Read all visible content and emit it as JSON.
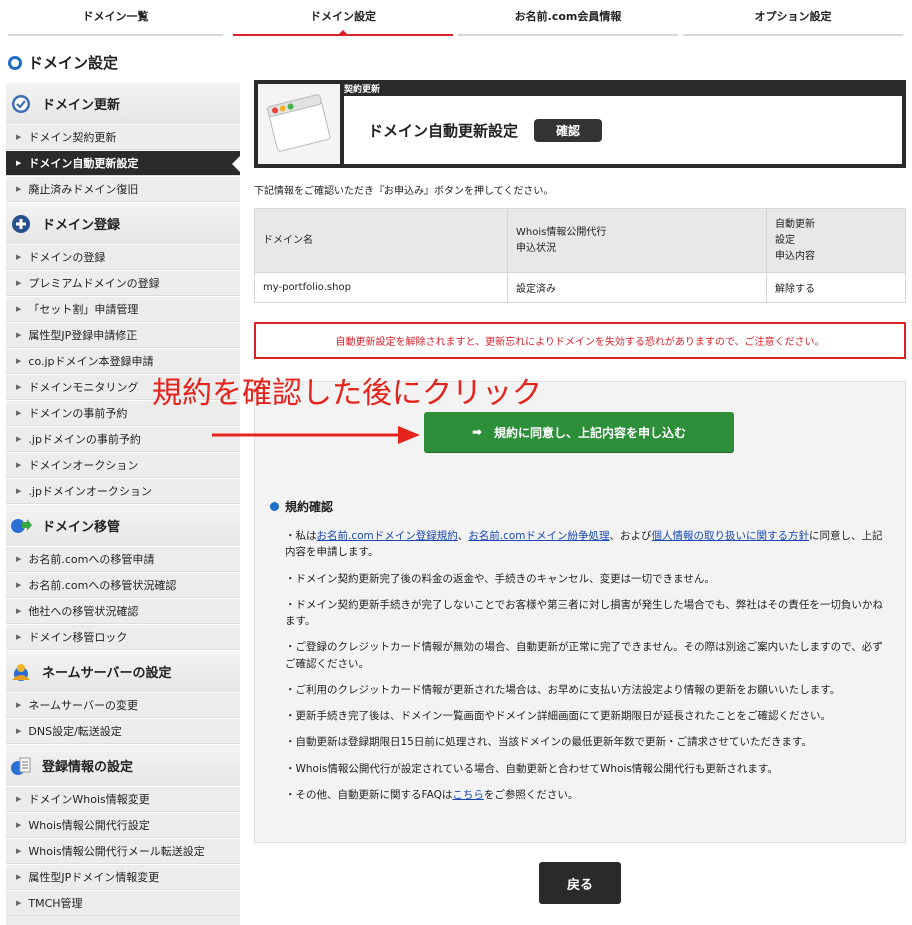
{
  "topnav": {
    "tabs": [
      {
        "label": "ドメイン一覧"
      },
      {
        "label": "ドメイン設定"
      },
      {
        "label": "お名前.com会員情報"
      },
      {
        "label": "オプション設定"
      }
    ]
  },
  "page_title": "ドメイン設定",
  "sidebar": {
    "sections": [
      {
        "title": "ドメイン更新",
        "icon": "check-circle-icon",
        "items": [
          "ドメイン契約更新",
          "ドメイン自動更新設定",
          "廃止済みドメイン復旧"
        ]
      },
      {
        "title": "ドメイン登録",
        "icon": "plus-circle-icon",
        "items": [
          "ドメインの登録",
          "プレミアムドメインの登録",
          "「セット割」申請管理",
          "属性型JP登録申請修正",
          "co.jpドメイン本登録申請",
          "ドメインモニタリング",
          "ドメインの事前予約",
          ".jpドメインの事前予約",
          "ドメインオークション",
          ".jpドメインオークション"
        ]
      },
      {
        "title": "ドメイン移管",
        "icon": "globe-arrow-icon",
        "items": [
          "お名前.comへの移管申請",
          "お名前.comへの移管状況確認",
          "他社への移管状況確認",
          "ドメイン移管ロック"
        ]
      },
      {
        "title": "ネームサーバーの設定",
        "icon": "user-globe-icon",
        "items": [
          "ネームサーバーの変更",
          "DNS設定/転送設定"
        ]
      },
      {
        "title": "登録情報の設定",
        "icon": "document-globe-icon",
        "items": [
          "ドメインWhois情報変更",
          "Whois情報公開代行設定",
          "Whois情報公開代行メール転送設定",
          "属性型JPドメイン情報変更",
          "TMCH管理"
        ]
      }
    ]
  },
  "hero": {
    "label": "契約更新",
    "heading": "ドメイン自動更新設定",
    "badge": "確認"
  },
  "instruction": "下記情報をご確認いただき『お申込み』ボタンを押してください。",
  "table": {
    "headers": [
      "ドメイン名",
      "Whois情報公開代行\n申込状況",
      "自動更新\n設定\n申込内容"
    ],
    "row": [
      "my-portfolio.shop",
      "設定済み",
      "解除する"
    ]
  },
  "warning": "自動更新設定を解除されますと、更新忘れによりドメインを失効する恐れがありますので、ご注意ください。",
  "annotation": "規約を確認した後にクリック",
  "agree_button": "規約に同意し、上記内容を申し込む",
  "terms": {
    "title": "規約確認",
    "p1_prefix": "・私は",
    "link1": "お名前.comドメイン登録規約",
    "sep1": "、",
    "link2": "お名前.comドメイン紛争処理",
    "sep2": "、および",
    "link3": "個人情報の取り扱いに関する方針",
    "p1_suffix": "に同意し、上記内容を申請します。",
    "p2": "・ドメイン契約更新完了後の料金の返金や、手続きのキャンセル、変更は一切できません。",
    "p3": "・ドメイン契約更新手続きが完了しないことでお客様や第三者に対し損害が発生した場合でも、弊社はその責任を一切負いかねます。",
    "p4": "・ご登録のクレジットカード情報が無効の場合、自動更新が正常に完了できません。その際は別途ご案内いたしますので、必ずご確認ください。",
    "p5": "・ご利用のクレジットカード情報が更新された場合は、お早めに支払い方法設定より情報の更新をお願いいたします。",
    "p6": "・更新手続き完了後は、ドメイン一覧画面やドメイン詳細画面にて更新期限日が延長されたことをご確認ください。",
    "p7": "・自動更新は登録期限日15日前に処理され、当該ドメインの最低更新年数で更新・ご請求させていただきます。",
    "p8": "・Whois情報公開代行が設定されている場合、自動更新と合わせてWhois情報公開代行も更新されます。",
    "p9_prefix": "・その他、自動更新に関するFAQは",
    "p9_link": "こちら",
    "p9_suffix": "をご参照ください。"
  },
  "back_button": "戻る",
  "colors": {
    "accent_red": "#d9222a",
    "agree_green": "#2e8f3a",
    "link_blue": "#1a49b4",
    "brand_blue": "#1e6dc8"
  }
}
